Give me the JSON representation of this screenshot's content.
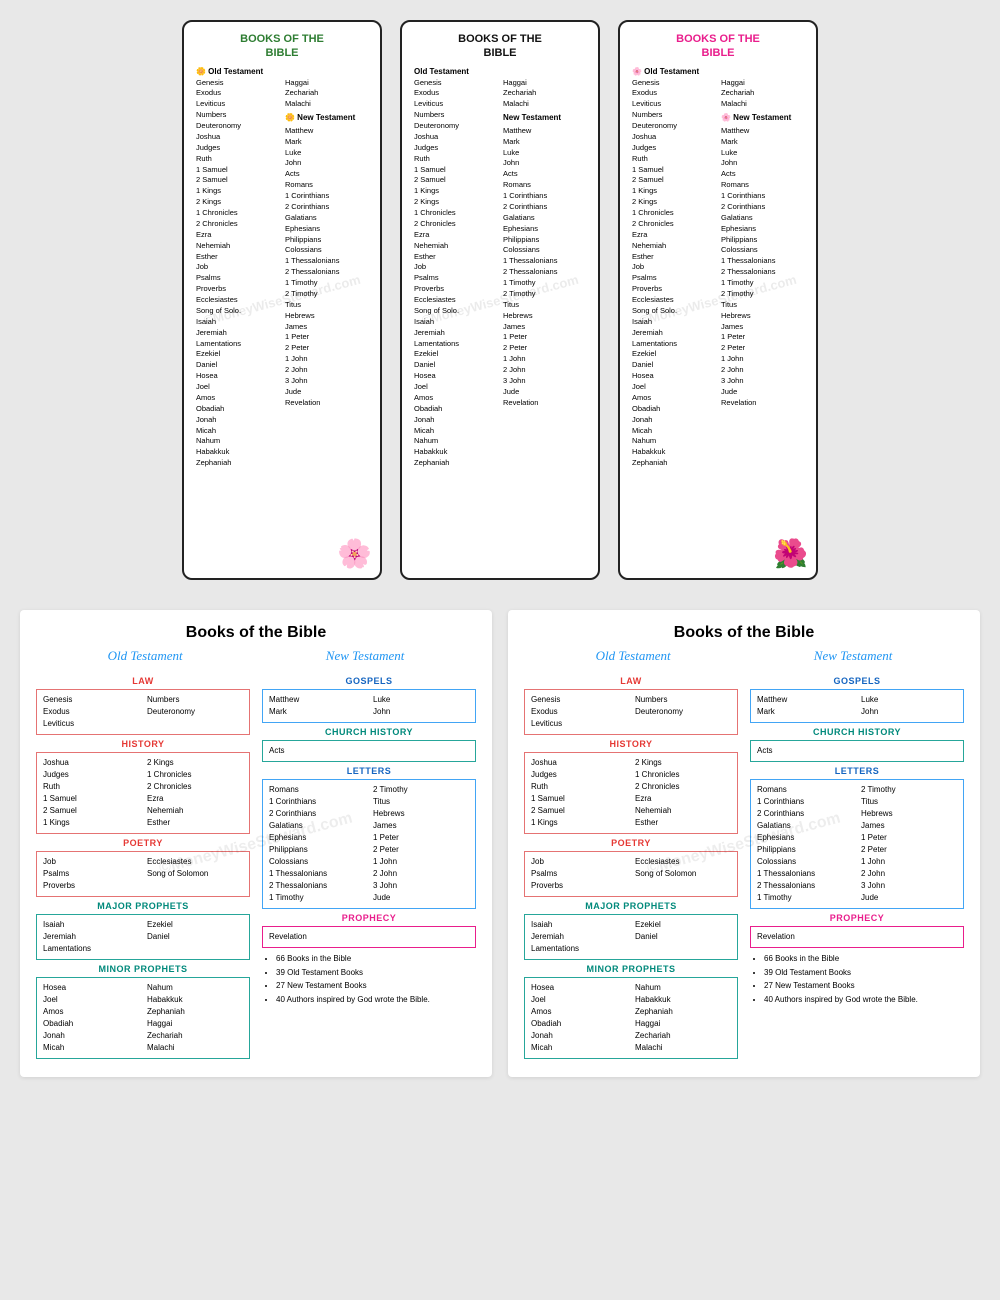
{
  "watermark": "©MoneyWiseSteward.com",
  "topSection": {
    "bookmarks": [
      {
        "id": "bookmark-1",
        "titleLines": [
          "BOOKS OF THE",
          "BIBLE"
        ],
        "titleColor": "green",
        "otLabel": "🌼 Old Testament",
        "ntLabel": "🌼 New Testament",
        "leftCol": [
          "Genesis",
          "Exodus",
          "Leviticus",
          "Numbers",
          "Deuteronomy",
          "Joshua",
          "Judges",
          "Ruth",
          "1 Samuel",
          "2 Samuel",
          "1 Kings",
          "2 Kings",
          "1 Chronicles",
          "2 Chronicles",
          "Ezra",
          "Nehemiah",
          "Esther",
          "Job",
          "Psalms",
          "Proverbs",
          "Ecclesiastes",
          "Song of Solo.",
          "Isaiah",
          "Jeremiah",
          "Lamentations",
          "Ezekiel",
          "Daniel",
          "Hosea",
          "Joel",
          "Amos",
          "Obadiah",
          "Jonah",
          "Micah",
          "Nahum",
          "Habakkuk",
          "Zephaniah"
        ],
        "rightCol": [
          "Haggai",
          "Zechariah",
          "Malachi",
          "",
          "Matthew",
          "Mark",
          "Luke",
          "John",
          "Acts",
          "Romans",
          "1 Corinthians",
          "2 Corinthians",
          "Galatians",
          "Ephesians",
          "Philippians",
          "Colossians",
          "1 Thessalonians",
          "2 Thessalonians",
          "1 Timothy",
          "2 Timothy",
          "Titus",
          "Hebrews",
          "James",
          "1 Peter",
          "2 Peter",
          "1 John",
          "2 John",
          "3 John",
          "Jude",
          "Revelation"
        ],
        "flowerEmoji": "🌸"
      },
      {
        "id": "bookmark-2",
        "titleLines": [
          "BOOKS OF THE",
          "BIBLE"
        ],
        "titleColor": "black",
        "otLabel": "Old Testament",
        "ntLabel": "New Testament",
        "leftCol": [
          "Genesis",
          "Exodus",
          "Leviticus",
          "Numbers",
          "Deuteronomy",
          "Joshua",
          "Judges",
          "Ruth",
          "1 Samuel",
          "2 Samuel",
          "1 Kings",
          "2 Kings",
          "1 Chronicles",
          "2 Chronicles",
          "Ezra",
          "Nehemiah",
          "Esther",
          "Job",
          "Psalms",
          "Proverbs",
          "Ecclesiastes",
          "Song of Solo.",
          "Isaiah",
          "Jeremiah",
          "Lamentations",
          "Ezekiel",
          "Daniel",
          "Hosea",
          "Joel",
          "Amos",
          "Obadiah",
          "Jonah",
          "Micah",
          "Nahum",
          "Habakkuk",
          "Zephaniah"
        ],
        "rightCol": [
          "Haggai",
          "Zechariah",
          "Malachi",
          "",
          "Matthew",
          "Mark",
          "Luke",
          "John",
          "Acts",
          "Romans",
          "1 Corinthians",
          "2 Corinthians",
          "Galatians",
          "Ephesians",
          "Philippians",
          "Colossians",
          "1 Thessalonians",
          "2 Thessalonians",
          "1 Timothy",
          "2 Timothy",
          "Titus",
          "Hebrews",
          "James",
          "1 Peter",
          "2 Peter",
          "1 John",
          "2 John",
          "3 John",
          "Jude",
          "Revelation"
        ]
      },
      {
        "id": "bookmark-3",
        "titleLines": [
          "BOOKS OF THE",
          "BIBLE"
        ],
        "titleColor": "pink",
        "otLabel": "🌸 Old Testament",
        "ntLabel": "🌸 New Testament",
        "leftCol": [
          "Genesis",
          "Exodus",
          "Leviticus",
          "Numbers",
          "Deuteronomy",
          "Joshua",
          "Judges",
          "Ruth",
          "1 Samuel",
          "2 Samuel",
          "1 Kings",
          "2 Kings",
          "1 Chronicles",
          "2 Chronicles",
          "Ezra",
          "Nehemiah",
          "Esther",
          "Job",
          "Psalms",
          "Proverbs",
          "Ecclesiastes",
          "Song of Solo.",
          "Isaiah",
          "Jeremiah",
          "Lamentations",
          "Ezekiel",
          "Daniel",
          "Hosea",
          "Joel",
          "Amos",
          "Obadiah",
          "Jonah",
          "Micah",
          "Nahum",
          "Habakkuk",
          "Zephaniah"
        ],
        "rightCol": [
          "Haggai",
          "Zechariah",
          "Malachi",
          "",
          "Matthew",
          "Mark",
          "Luke",
          "John",
          "Acts",
          "Romans",
          "1 Corinthians",
          "2 Corinthians",
          "Galatians",
          "Ephesians",
          "Philippians",
          "Colossians",
          "1 Thessalonians",
          "2 Thessalonians",
          "1 Timothy",
          "2 Timothy",
          "Titus",
          "Hebrews",
          "James",
          "1 Peter",
          "2 Peter",
          "1 John",
          "2 John",
          "3 John",
          "Jude",
          "Revelation"
        ],
        "flowerEmoji": "🌺"
      }
    ]
  },
  "bottomSection": {
    "sheets": [
      {
        "id": "sheet-1",
        "title": "Books of the Bible",
        "otLabel": "Old Testament",
        "ntLabel": "New Testament",
        "ot": {
          "lawHeader": "LAW",
          "lawBooks": [
            [
              "Genesis",
              "Numbers"
            ],
            [
              "Exodus",
              "Deuteronomy"
            ],
            [
              "Leviticus",
              ""
            ]
          ],
          "historyHeader": "HISTORY",
          "historyLeft": [
            "Joshua",
            "Judges",
            "Ruth",
            "1 Samuel",
            "2 Samuel",
            "1 Kings"
          ],
          "historyRight": [
            "2 Kings",
            "1 Chronicles",
            "2 Chronicles",
            "Ezra",
            "Nehemiah",
            "Esther"
          ],
          "poetryHeader": "POETRY",
          "poetryBooks": [
            [
              "Job",
              "Ecclesiastes"
            ],
            [
              "Psalms",
              "Song of Solomon"
            ],
            [
              "Proverbs",
              ""
            ]
          ],
          "majorHeader": "MAJOR PROPHETS",
          "majorLeft": [
            "Isaiah",
            "Jeremiah",
            "Lamentations"
          ],
          "majorRight": [
            "Ezekiel",
            "Daniel"
          ],
          "minorHeader": "MINOR PROPHETS",
          "minorLeft": [
            "Hosea",
            "Joel",
            "Amos",
            "Obadiah",
            "Jonah",
            "Micah"
          ],
          "minorRight": [
            "Nahum",
            "Habakkuk",
            "Zephaniah",
            "Haggai",
            "Zechariah",
            "Malachi"
          ]
        },
        "nt": {
          "gospelsHeader": "GOSPELS",
          "gospelsLeft": [
            "Matthew",
            "Mark"
          ],
          "gospelsRight": [
            "Luke",
            "John"
          ],
          "churchHeader": "CHURCH HISTORY",
          "churchBooks": [
            "Acts"
          ],
          "lettersHeader": "LETTERS",
          "lettersLeft": [
            "Romans",
            "1 Corinthians",
            "2 Corinthians",
            "Galatians",
            "Ephesians",
            "Philippians",
            "Colossians",
            "1 Thessalonians",
            "2 Thessalonians",
            "1 Timothy"
          ],
          "lettersRight": [
            "2 Timothy",
            "Titus",
            "Hebrews",
            "James",
            "1 Peter",
            "2 Peter",
            "1 John",
            "2 John",
            "3 John",
            "Jude"
          ],
          "prophecyHeader": "PROPHECY",
          "prophecyBooks": [
            "Revelation"
          ],
          "bullets": [
            "66 Books in the Bible",
            "39 Old Testament Books",
            "27 New Testament Books",
            "40 Authors inspired by God wrote the Bible."
          ]
        }
      },
      {
        "id": "sheet-2",
        "title": "Books of the Bible",
        "otLabel": "Old Testament",
        "ntLabel": "New Testament",
        "ot": {
          "lawHeader": "LAW",
          "lawBooks": [
            [
              "Genesis",
              "Numbers"
            ],
            [
              "Exodus",
              "Deuteronomy"
            ],
            [
              "Leviticus",
              ""
            ]
          ],
          "historyHeader": "HISTORY",
          "historyLeft": [
            "Joshua",
            "Judges",
            "Ruth",
            "1 Samuel",
            "2 Samuel",
            "1 Kings"
          ],
          "historyRight": [
            "2 Kings",
            "1 Chronicles",
            "2 Chronicles",
            "Ezra",
            "Nehemiah",
            "Esther"
          ],
          "poetryHeader": "POETRY",
          "poetryBooks": [
            [
              "Job",
              "Ecclesiastes"
            ],
            [
              "Psalms",
              "Song of Solomon"
            ],
            [
              "Proverbs",
              ""
            ]
          ],
          "majorHeader": "MAJOR PROPHETS",
          "majorLeft": [
            "Isaiah",
            "Jeremiah",
            "Lamentations"
          ],
          "majorRight": [
            "Ezekiel",
            "Daniel"
          ],
          "minorHeader": "MINOR PROPHETS",
          "minorLeft": [
            "Hosea",
            "Joel",
            "Amos",
            "Obadiah",
            "Jonah",
            "Micah"
          ],
          "minorRight": [
            "Nahum",
            "Habakkuk",
            "Zephaniah",
            "Haggai",
            "Zechariah",
            "Malachi"
          ]
        },
        "nt": {
          "gospelsHeader": "GOSPELS",
          "gospelsLeft": [
            "Matthew",
            "Mark"
          ],
          "gospelsRight": [
            "Luke",
            "John"
          ],
          "churchHeader": "CHURCH HISTORY",
          "churchBooks": [
            "Acts"
          ],
          "lettersHeader": "LETTERS",
          "lettersLeft": [
            "Romans",
            "1 Corinthians",
            "2 Corinthians",
            "Galatians",
            "Ephesians",
            "Philippians",
            "Colossians",
            "1 Thessalonians",
            "2 Thessalonians",
            "1 Timothy"
          ],
          "lettersRight": [
            "2 Timothy",
            "Titus",
            "Hebrews",
            "James",
            "1 Peter",
            "2 Peter",
            "1 John",
            "2 John",
            "3 John",
            "Jude"
          ],
          "prophecyHeader": "PROPHECY",
          "prophecyBooks": [
            "Revelation"
          ],
          "bullets": [
            "66 Books in the Bible",
            "39 Old Testament Books",
            "27 New Testament Books",
            "40 Authors inspired by God wrote the Bible."
          ]
        }
      }
    ]
  }
}
